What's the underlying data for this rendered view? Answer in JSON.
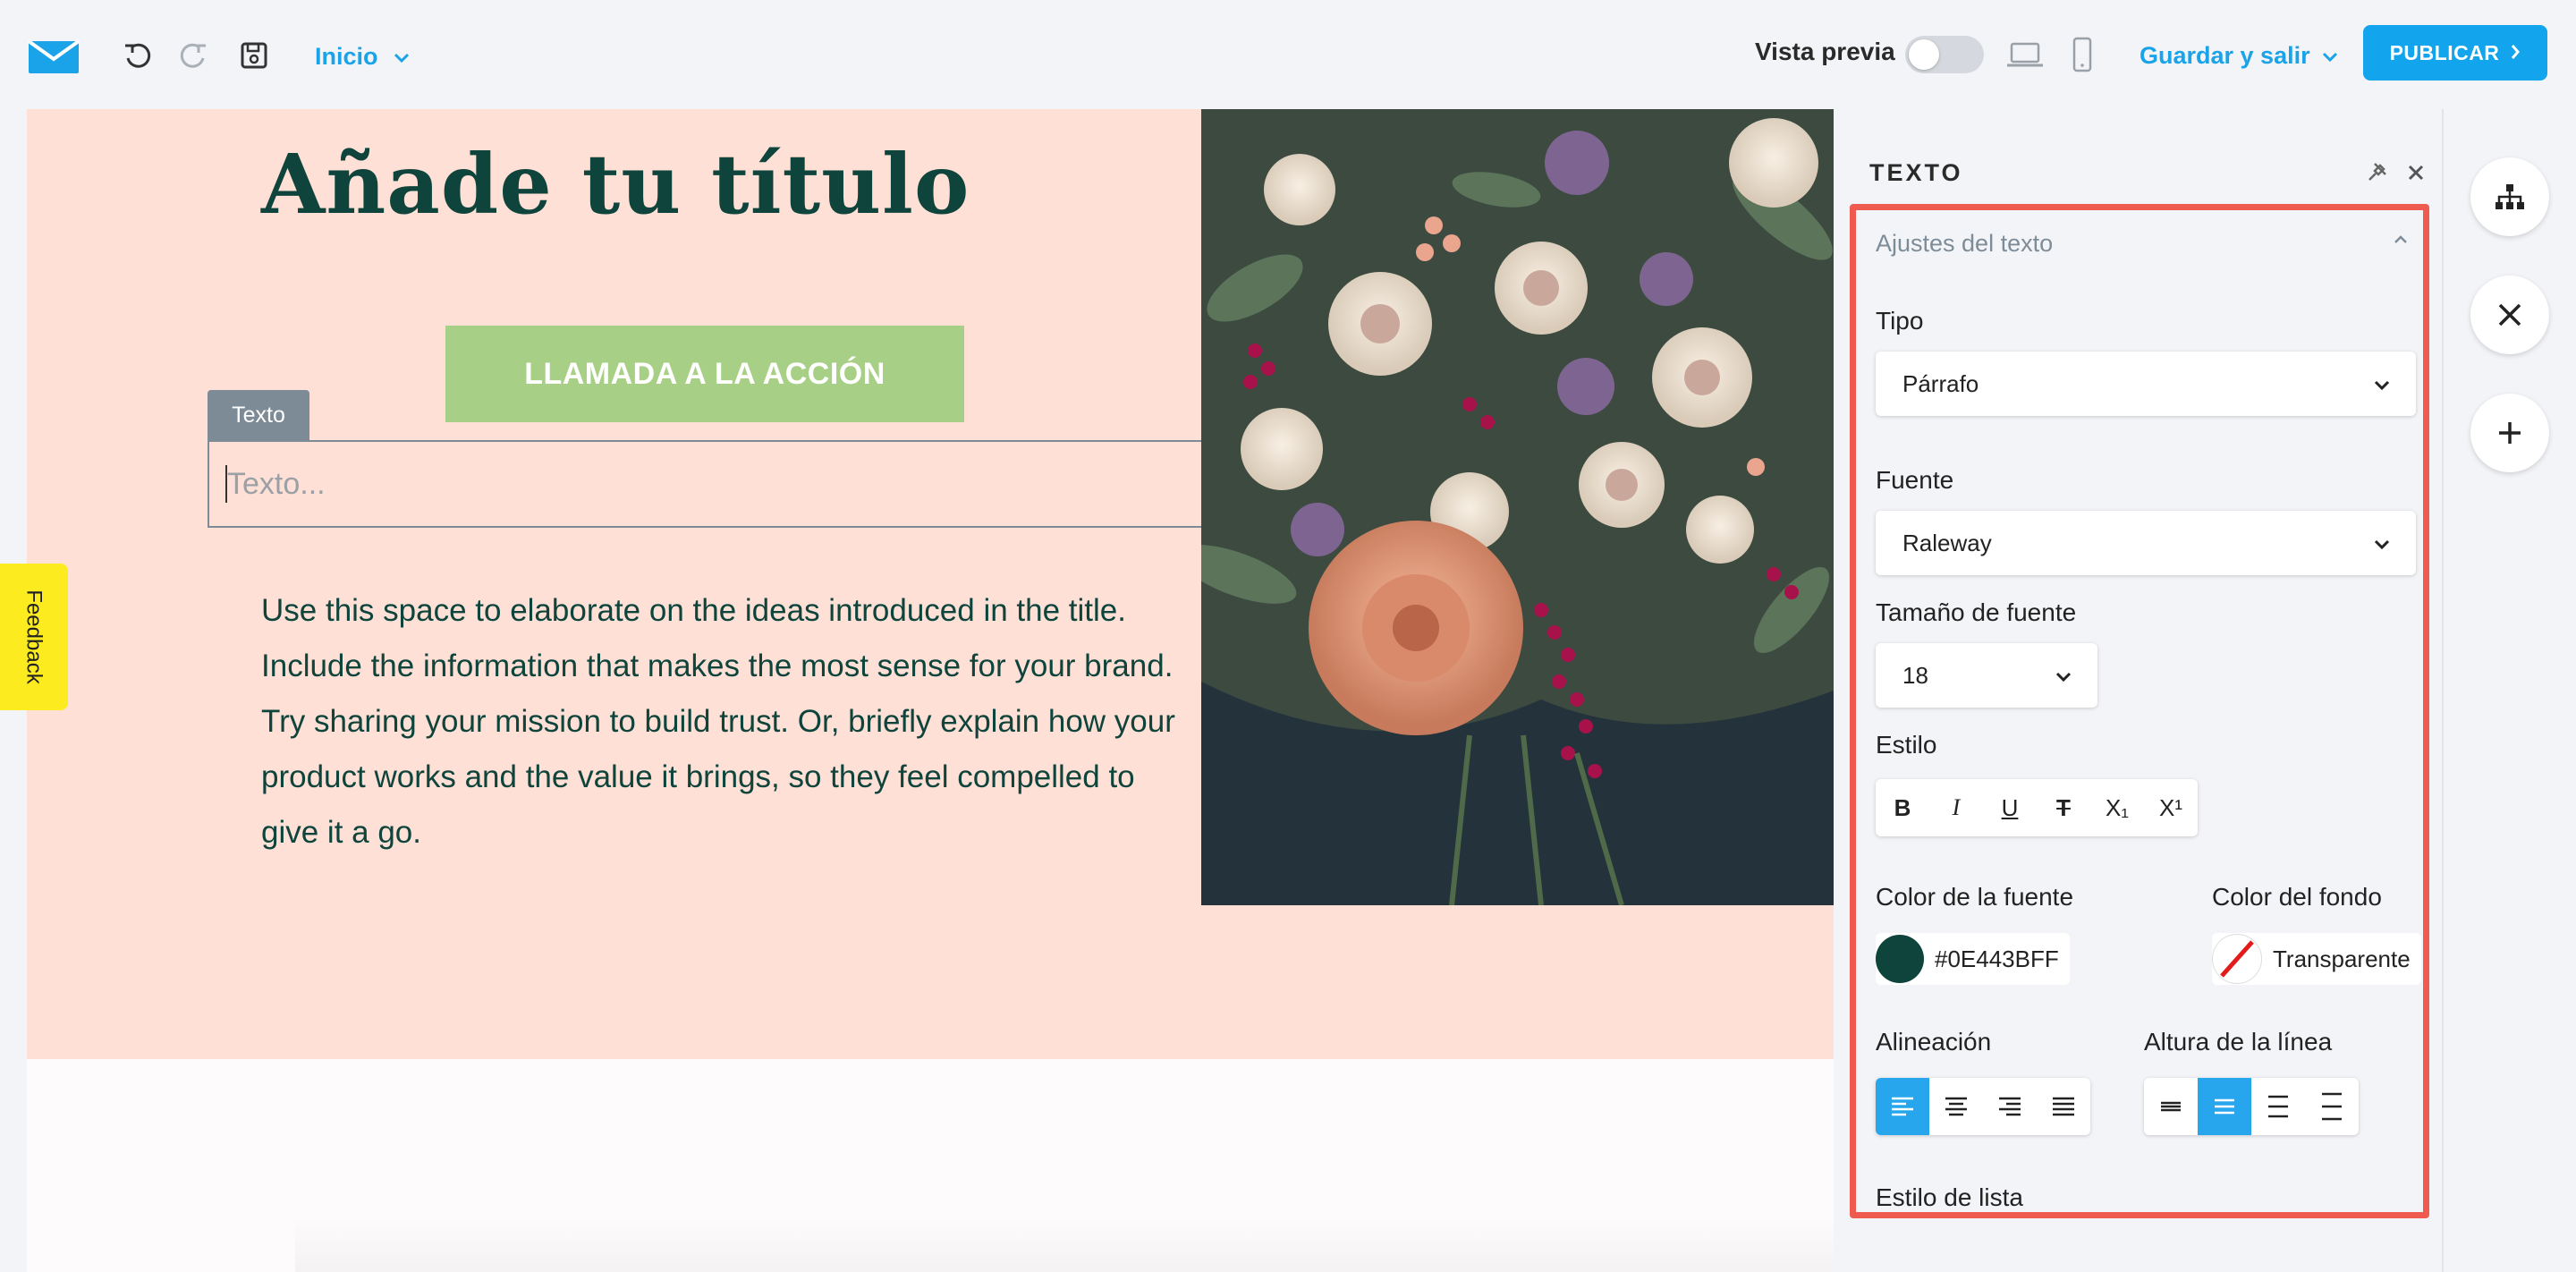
{
  "topbar": {
    "page_name": "Inicio",
    "preview_label": "Vista previa",
    "save_exit_label": "Guardar y salir",
    "publish_label": "PUBLICAR"
  },
  "canvas": {
    "title": "Añade tu título",
    "cta_label": "LLAMADA A LA ACCIÓN",
    "text_tag": "Texto",
    "text_placeholder": "Texto...",
    "body": "Use this space to elaborate on the ideas introduced in the title. Include the information that makes the most sense for your brand. Try sharing your mission to build trust. Or, briefly explain how your product works and the value it brings, so they feel compelled to give it a go."
  },
  "feedback_label": "Feedback",
  "panel": {
    "title": "TEXTO",
    "section_title": "Ajustes del texto",
    "type_label": "Tipo",
    "type_value": "Párrafo",
    "font_label": "Fuente",
    "font_value": "Raleway",
    "size_label": "Tamaño de fuente",
    "size_value": "18",
    "style_label": "Estilo",
    "style_buttons": [
      "B",
      "I",
      "U",
      "T",
      "X₁",
      "X¹"
    ],
    "font_color_label": "Color de la fuente",
    "font_color_value": "#0E443BFF",
    "bg_color_label": "Color del fondo",
    "bg_color_value": "Transparente",
    "align_label": "Alineación",
    "line_height_label": "Altura de la línea",
    "list_style_label": "Estilo de lista"
  },
  "colors": {
    "brand_blue": "#1aa3e8",
    "hero_bg": "#fee0d6",
    "title_green": "#0e443b",
    "cta_green": "#a7cf85",
    "highlight_red": "#ef5b4f",
    "feedback_yellow": "#fbeb1f",
    "font_color_swatch": "#0e443b"
  },
  "icons": {
    "logo": "envelope-logo-icon",
    "undo": "undo-icon",
    "redo": "redo-icon",
    "save": "save-icon",
    "desktop": "desktop-icon",
    "mobile": "mobile-icon",
    "structure": "sitemap-icon",
    "close_rail": "close-x-icon",
    "add": "plus-icon"
  }
}
